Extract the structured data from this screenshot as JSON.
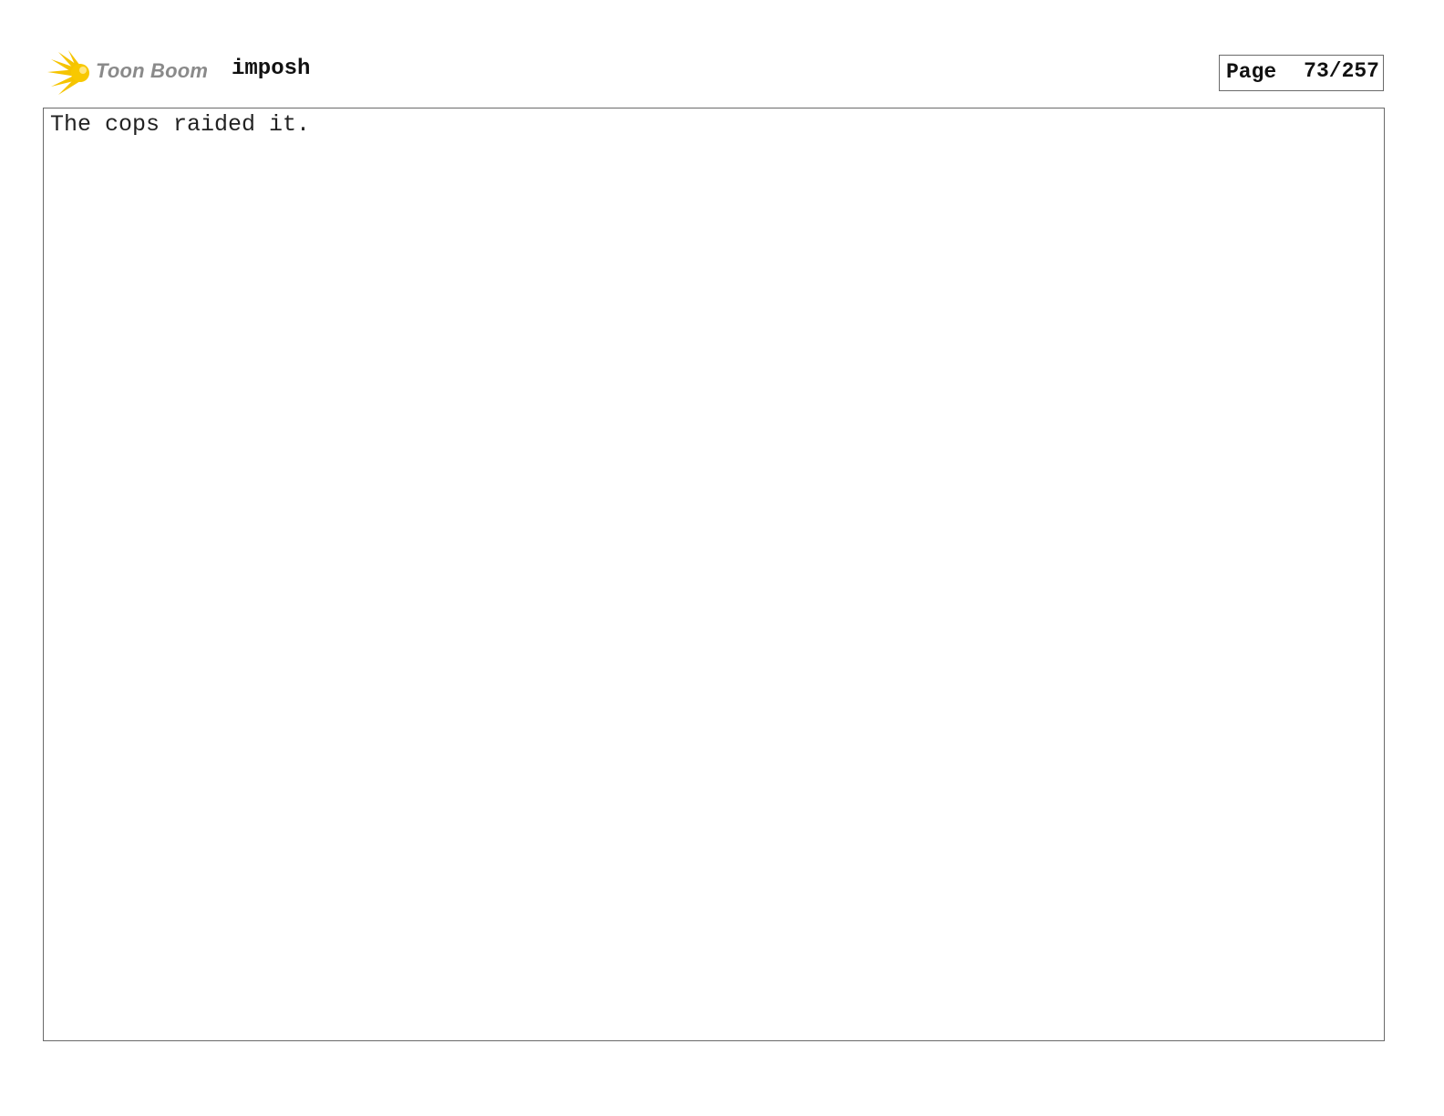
{
  "header": {
    "logo": {
      "icon": "starburst-icon",
      "brand_text": "Toon Boom",
      "brand_color": "#8a8a8a",
      "accent_color": "#f5c400"
    },
    "project_title": "imposh",
    "page": {
      "label": "Page",
      "number": "73/257"
    }
  },
  "panel": {
    "caption": "The cops raided it."
  }
}
